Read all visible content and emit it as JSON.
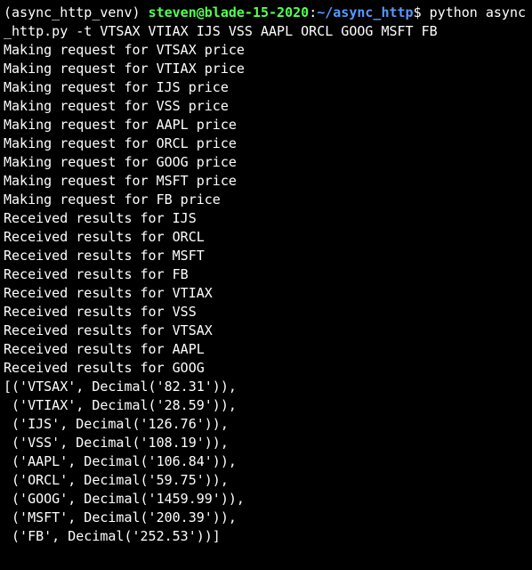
{
  "prompt": {
    "venv": "(async_http_venv)",
    "user_host": "steven@blade-15-2020",
    "colon": ":",
    "path": "~/async_http",
    "dollar": "$",
    "command": "python async_http.py -t VTSAX VTIAX IJS VSS AAPL ORCL GOOG MSFT FB"
  },
  "making_requests": [
    "Making request for VTSAX price",
    "Making request for VTIAX price",
    "Making request for IJS price",
    "Making request for VSS price",
    "Making request for AAPL price",
    "Making request for ORCL price",
    "Making request for GOOG price",
    "Making request for MSFT price",
    "Making request for FB price"
  ],
  "received_results": [
    "Received results for IJS",
    "Received results for ORCL",
    "Received results for MSFT",
    "Received results for FB",
    "Received results for VTIAX",
    "Received results for VSS",
    "Received results for VTSAX",
    "Received results for AAPL",
    "Received results for GOOG"
  ],
  "result_lines": [
    "[('VTSAX', Decimal('82.31')),",
    " ('VTIAX', Decimal('28.59')),",
    " ('IJS', Decimal('126.76')),",
    " ('VSS', Decimal('108.19')),",
    " ('AAPL', Decimal('106.84')),",
    " ('ORCL', Decimal('59.75')),",
    " ('GOOG', Decimal('1459.99')),",
    " ('MSFT', Decimal('200.39')),",
    " ('FB', Decimal('252.53'))]"
  ]
}
